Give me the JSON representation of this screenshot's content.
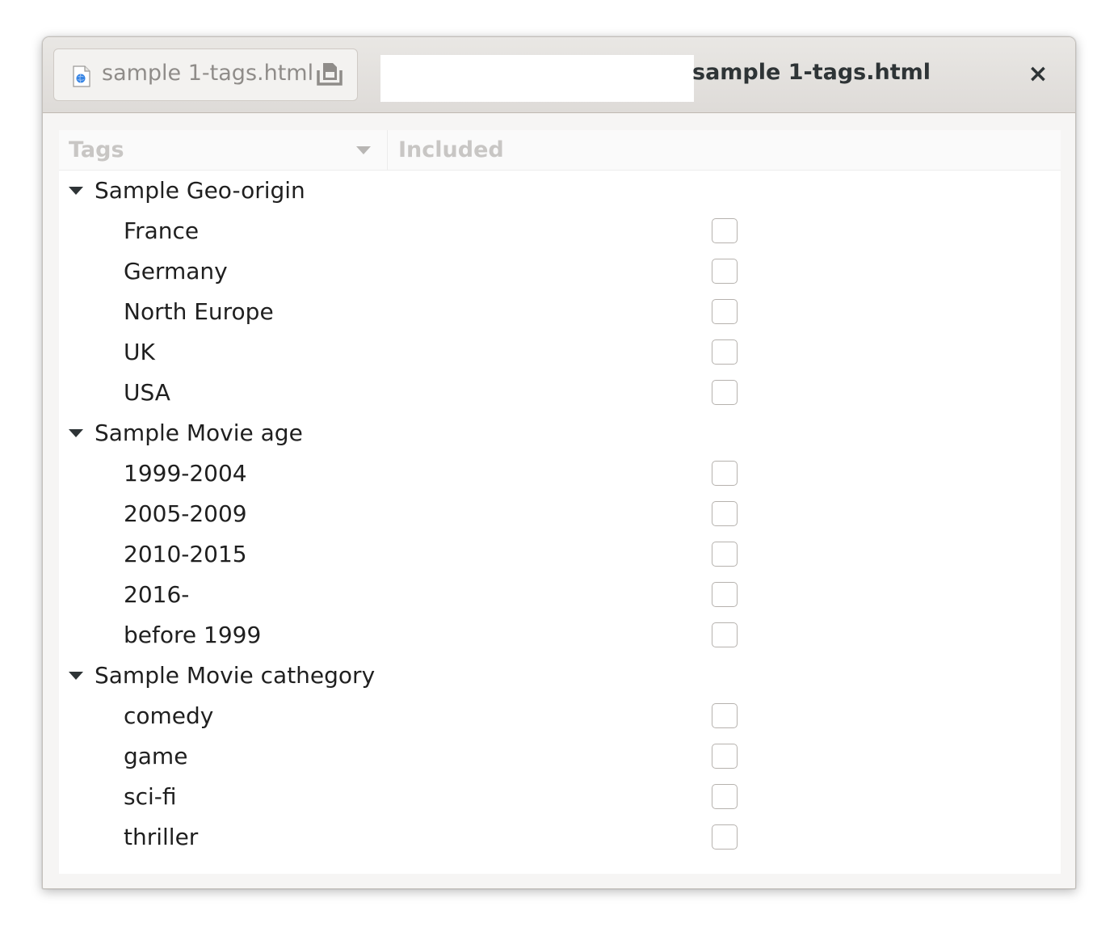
{
  "window": {
    "tab_label": "sample 1-tags.html",
    "title": "sample 1-tags.html",
    "close_glyph": "×"
  },
  "icons": {
    "file": "html-file-icon",
    "save": "save-document-icon",
    "close": "close-icon",
    "expander": "expander-triangle-icon",
    "sort": "sort-descending-icon"
  },
  "columns": {
    "tags": "Tags",
    "included": "Included"
  },
  "groups": [
    {
      "label": "Sample Geo-origin",
      "items": [
        {
          "label": "France",
          "checked": false
        },
        {
          "label": "Germany",
          "checked": false
        },
        {
          "label": "North Europe",
          "checked": false
        },
        {
          "label": "UK",
          "checked": false
        },
        {
          "label": "USA",
          "checked": false
        }
      ]
    },
    {
      "label": "Sample Movie age",
      "items": [
        {
          "label": "1999-2004",
          "checked": false
        },
        {
          "label": "2005-2009",
          "checked": false
        },
        {
          "label": "2010-2015",
          "checked": false
        },
        {
          "label": "2016-",
          "checked": false
        },
        {
          "label": "before 1999",
          "checked": false
        }
      ]
    },
    {
      "label": "Sample Movie cathegory",
      "items": [
        {
          "label": "comedy",
          "checked": false
        },
        {
          "label": "game",
          "checked": false
        },
        {
          "label": "sci-fi",
          "checked": false
        },
        {
          "label": "thriller",
          "checked": false
        }
      ]
    }
  ]
}
